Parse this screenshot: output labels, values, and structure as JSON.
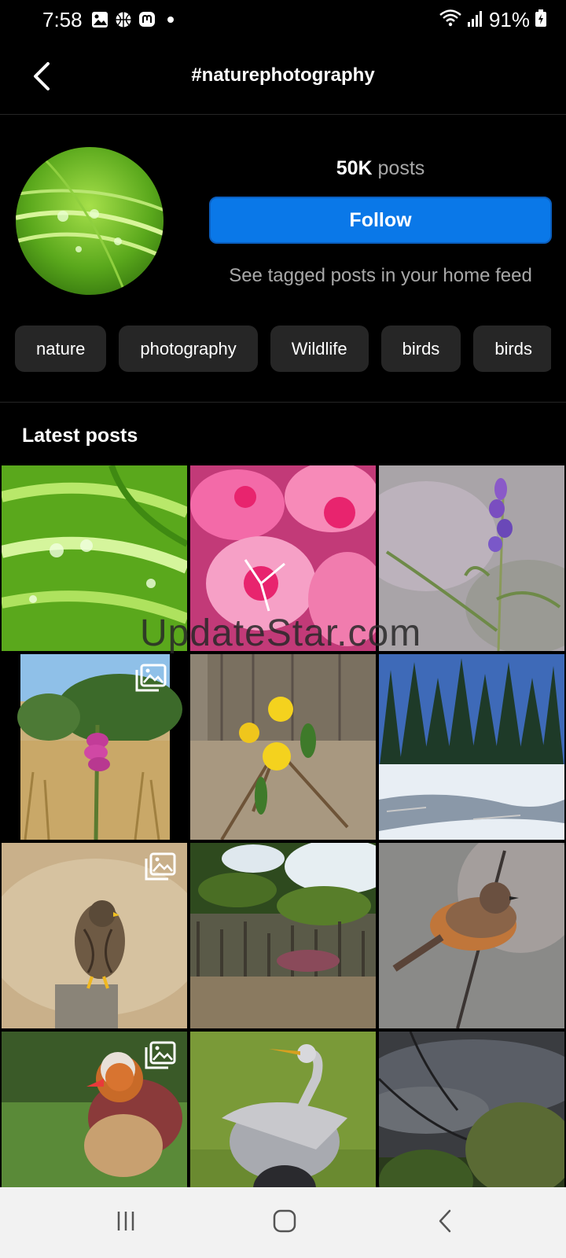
{
  "status_bar": {
    "time": "7:58",
    "battery": "91%",
    "left_icons": [
      "gallery-icon",
      "basketball-icon",
      "mastodon-icon",
      "dot-icon"
    ],
    "right_icons": [
      "wifi-icon",
      "signal-icon",
      "battery-icon"
    ]
  },
  "header": {
    "title": "#naturephotography",
    "back_icon": "chevron-left-icon"
  },
  "profile": {
    "posts_count": "50K",
    "posts_label": "posts",
    "follow_label": "Follow",
    "tagged_note": "See tagged posts in your home feed"
  },
  "chips": [
    "nature",
    "photography",
    "Wildlife",
    "birds",
    "birds"
  ],
  "latest_posts": {
    "title": "Latest posts",
    "tiles": [
      {
        "subject": "green leaves with water droplets",
        "multi": false
      },
      {
        "subject": "pink geranium flowers",
        "multi": false
      },
      {
        "subject": "purple lupine flower",
        "multi": false
      },
      {
        "subject": "foxglove in field",
        "multi": true
      },
      {
        "subject": "yellow jasmine flowers",
        "multi": false
      },
      {
        "subject": "snowy pine forest",
        "multi": false
      },
      {
        "subject": "merlin falcon on post",
        "multi": true
      },
      {
        "subject": "mossy bank with snow",
        "multi": false
      },
      {
        "subject": "stonechat bird on branch",
        "multi": false
      },
      {
        "subject": "mandarin duck",
        "multi": true
      },
      {
        "subject": "grey heron",
        "multi": false
      },
      {
        "subject": "stormy sky over trees",
        "multi": false
      }
    ]
  },
  "watermark": "UpdateStar.com",
  "nav_bar": {
    "icons": [
      "recent-apps-icon",
      "home-icon",
      "back-icon"
    ]
  },
  "colors": {
    "background": "#000000",
    "accent": "#0a78e8",
    "chip": "#262626",
    "muted_text": "#a8a8a8"
  }
}
